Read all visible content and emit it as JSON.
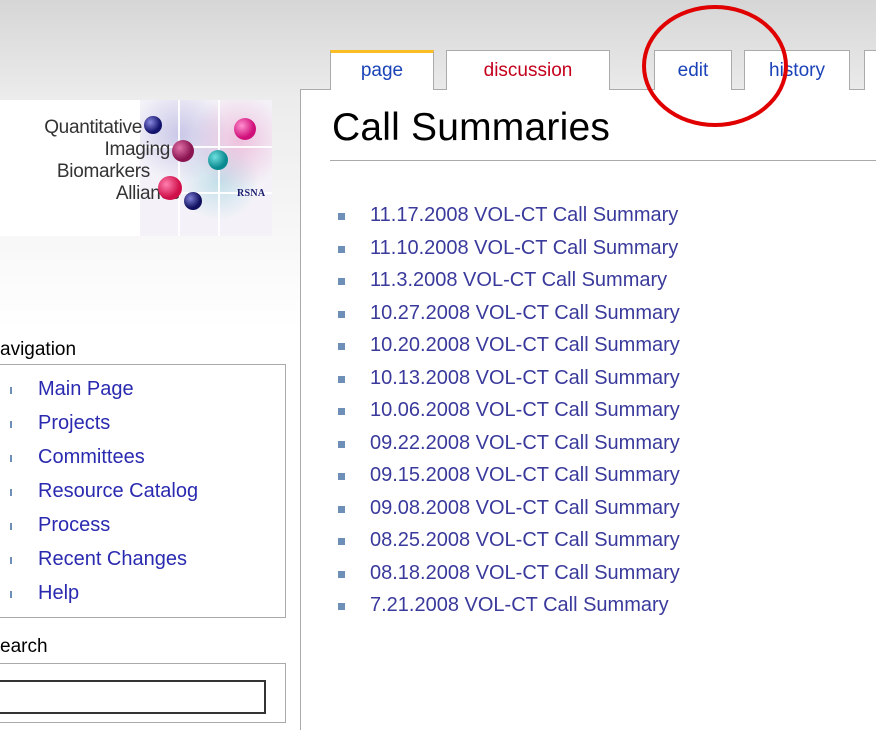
{
  "logo": {
    "line1": "Quantitative",
    "line2": "Imaging",
    "line3": "Biomarkers",
    "line4": "Alliance",
    "mark": "RSNA"
  },
  "tabs": [
    {
      "label": "page",
      "color": "#1a43b8",
      "selected": true
    },
    {
      "label": "discussion",
      "color": "#c4001d",
      "selected": false
    },
    {
      "label": "edit",
      "color": "#1a43b8",
      "selected": false
    },
    {
      "label": "history",
      "color": "#1a43b8",
      "selected": false
    }
  ],
  "page_title": "Call Summaries",
  "summaries": [
    "11.17.2008 VOL-CT Call Summary",
    "11.10.2008 VOL-CT Call Summary",
    "11.3.2008 VOL-CT Call Summary",
    "10.27.2008 VOL-CT Call Summary",
    "10.20.2008 VOL-CT Call Summary",
    "10.13.2008 VOL-CT Call Summary",
    "10.06.2008 VOL-CT Call Summary",
    "09.22.2008 VOL-CT Call Summary",
    "09.15.2008 VOL-CT Call Summary",
    "09.08.2008 VOL-CT Call Summary",
    "08.25.2008 VOL-CT Call Summary",
    "08.18.2008 VOL-CT Call Summary",
    "7.21.2008 VOL-CT Call Summary"
  ],
  "sidebar": {
    "navigation_heading": "avigation",
    "nav_items": [
      "Main Page",
      "Projects",
      "Committees",
      "Resource Catalog",
      "Process",
      "Recent Changes",
      "Help"
    ],
    "search_heading": "earch"
  },
  "annotation": {
    "color": "#e00000",
    "target": "edit tab"
  }
}
